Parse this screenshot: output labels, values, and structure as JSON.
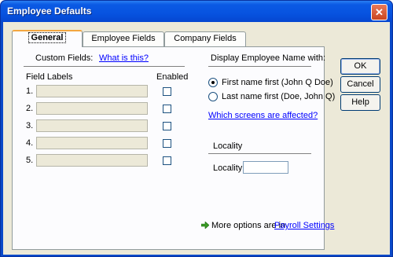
{
  "window": {
    "title": "Employee Defaults",
    "close_glyph": "✕"
  },
  "tabs": [
    {
      "label": "General",
      "active": true
    },
    {
      "label": "Employee Fields",
      "active": false
    },
    {
      "label": "Company Fields",
      "active": false
    }
  ],
  "custom_fields": {
    "heading": "Custom Fields:",
    "help_link": "What is this?",
    "col_labels": "Field Labels",
    "col_enabled": "Enabled",
    "rows": [
      {
        "num": "1.",
        "value": "",
        "enabled": false
      },
      {
        "num": "2.",
        "value": "",
        "enabled": false
      },
      {
        "num": "3.",
        "value": "",
        "enabled": false
      },
      {
        "num": "4.",
        "value": "",
        "enabled": false
      },
      {
        "num": "5.",
        "value": "",
        "enabled": false
      }
    ]
  },
  "display_name": {
    "heading": "Display Employee Name with:",
    "option_first": "First name first (John Q Doe)",
    "option_last": "Last name first (Doe, John Q)",
    "selected": "first",
    "screens_link": "Which screens are affected?"
  },
  "locality": {
    "heading": "Locality",
    "label": "Locality:",
    "value": ""
  },
  "footer": {
    "more_text": "More options are in",
    "more_link": "Payroll Settings",
    "icon": "green-arrow-icon"
  },
  "buttons": {
    "ok": "OK",
    "cancel": "Cancel",
    "help": "Help"
  },
  "colors": {
    "titlebar": "#0753e0",
    "dialog_bg": "#ece9d8",
    "tab_highlight": "#f3a640",
    "link": "#0000ff"
  }
}
